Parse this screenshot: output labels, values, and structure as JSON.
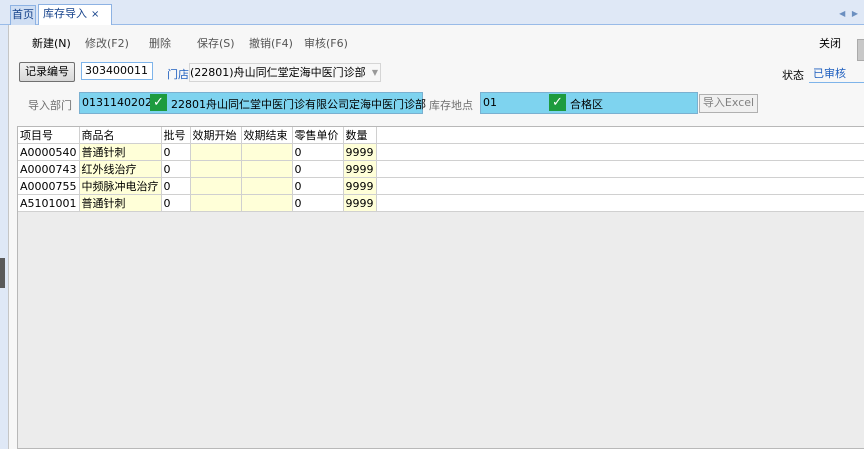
{
  "tabs": {
    "home": "首页",
    "active": "库存导入",
    "close": "×"
  },
  "toolbar": {
    "new": "新建(N)",
    "edit": "修改(F2)",
    "delete": "删除",
    "save": "保存(S)",
    "undo": "撤销(F4)",
    "audit": "审核(F6)",
    "close": "关闭"
  },
  "form": {
    "record_button": "记录编号",
    "record_value": "303400011",
    "store_label": "门店",
    "store_value": "(22801)舟山同仁堂定海中医门诊部",
    "status_label": "状态",
    "status_value": "已审核",
    "dept_label": "导入部门",
    "dept_code": "0131140202",
    "dept_name": "22801舟山同仁堂中医门诊有限公司定海中医门诊部",
    "location_label": "库存地点",
    "location_code": "01",
    "location_name": "合格区",
    "import_button": "导入Excel"
  },
  "table": {
    "headers": [
      "项目号",
      "商品名",
      "批号",
      "效期开始",
      "效期结束",
      "零售单价",
      "数量"
    ],
    "rows": [
      [
        "A0000540",
        "普通针刺",
        "0",
        "",
        "",
        "0",
        "9999"
      ],
      [
        "A0000743",
        "红外线治疗",
        "0",
        "",
        "",
        "0",
        "9999"
      ],
      [
        "A0000755",
        "中频脉冲电治疗",
        "0",
        "",
        "",
        "0",
        "9999"
      ],
      [
        "A5101001",
        "普通针刺",
        "0",
        "",
        "",
        "0",
        "9999"
      ]
    ]
  },
  "colors": {
    "picker_bg": "#7ed3ef",
    "check_green": "#1d9b3e",
    "status_blue": "#1f5fbf",
    "editable_cell": "#ffffd8"
  },
  "icons": {
    "check": "check-mark-icon"
  }
}
